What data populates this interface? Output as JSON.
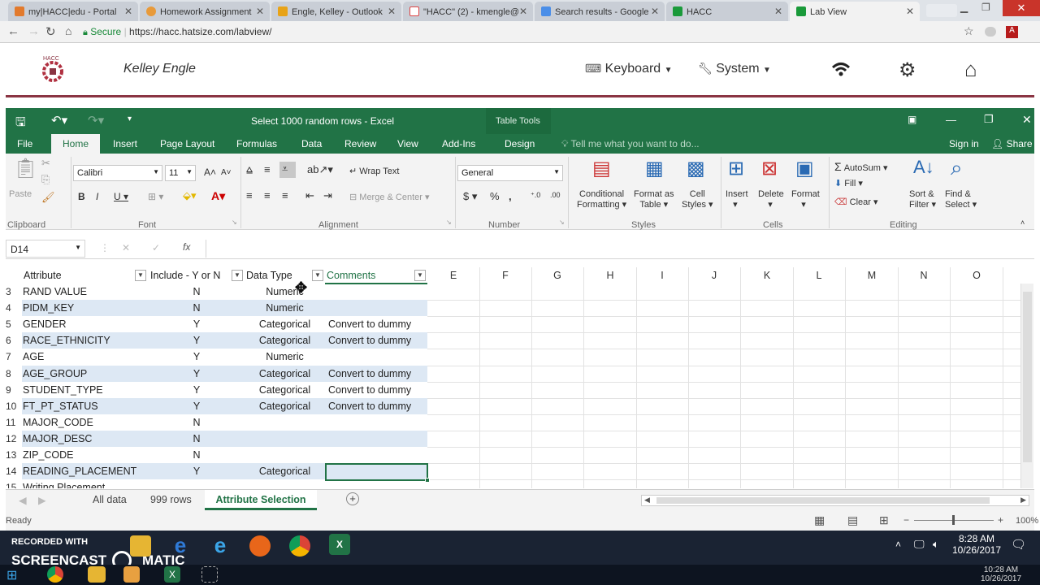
{
  "browser": {
    "tabs": [
      "my|HACC|edu - Portal",
      "Homework Assignment",
      "Engle, Kelley - Outlook",
      "\"HACC\" (2) - kmengle@",
      "Search results - Google",
      "HACC",
      "Lab View"
    ],
    "secure_label": "Secure",
    "url": "https://hacc.hatsize.com/labview/"
  },
  "lab": {
    "user": "Kelley Engle",
    "keyboard": "Keyboard",
    "system": "System"
  },
  "excel": {
    "title": "Select 1000 random rows  -  Excel",
    "table_tools": "Table Tools",
    "tabs": [
      "File",
      "Home",
      "Insert",
      "Page Layout",
      "Formulas",
      "Data",
      "Review",
      "View",
      "Add-Ins",
      "Design"
    ],
    "tell_me": "Tell me what you want to do...",
    "sign_in": "Sign in",
    "share": "Share",
    "ribbon": {
      "paste": "Paste",
      "clipboard": "Clipboard",
      "font_name": "Calibri",
      "font_size": "11",
      "font": "Font",
      "wrap_text": "Wrap Text",
      "merge_center": "Merge & Center",
      "alignment": "Alignment",
      "number_format": "General",
      "number": "Number",
      "conditional_formatting": [
        "Conditional",
        "Formatting"
      ],
      "format_as_table": [
        "Format as",
        "Table"
      ],
      "cell_styles": [
        "Cell",
        "Styles"
      ],
      "styles": "Styles",
      "insert": "Insert",
      "delete": "Delete",
      "format": "Format",
      "cells": "Cells",
      "autosum": "AutoSum",
      "fill": "Fill",
      "clear": "Clear",
      "sort_filter": [
        "Sort &",
        "Filter"
      ],
      "find_select": [
        "Find &",
        "Select"
      ],
      "editing": "Editing"
    },
    "name_box": "D14",
    "fx": "fx",
    "columns": [
      "E",
      "F",
      "G",
      "H",
      "I",
      "J",
      "K",
      "L",
      "M",
      "N",
      "O"
    ],
    "headers": [
      "Attribute",
      "Include - Y or N",
      "Data Type",
      "Comments"
    ],
    "rows": [
      {
        "n": "3",
        "attr": "RAND VALUE",
        "inc": "N",
        "type": "Numeric",
        "comment": ""
      },
      {
        "n": "4",
        "attr": "PIDM_KEY",
        "inc": "N",
        "type": "Numeric",
        "comment": ""
      },
      {
        "n": "5",
        "attr": "GENDER",
        "inc": "Y",
        "type": "Categorical",
        "comment": "Convert to dummy"
      },
      {
        "n": "6",
        "attr": "RACE_ETHNICITY",
        "inc": "Y",
        "type": "Categorical",
        "comment": "Convert to dummy"
      },
      {
        "n": "7",
        "attr": "AGE",
        "inc": "Y",
        "type": "Numeric",
        "comment": ""
      },
      {
        "n": "8",
        "attr": "AGE_GROUP",
        "inc": "Y",
        "type": "Categorical",
        "comment": "Convert to dummy"
      },
      {
        "n": "9",
        "attr": "STUDENT_TYPE",
        "inc": "Y",
        "type": "Categorical",
        "comment": "Convert to dummy"
      },
      {
        "n": "10",
        "attr": "FT_PT_STATUS",
        "inc": "Y",
        "type": "Categorical",
        "comment": "Convert to dummy"
      },
      {
        "n": "11",
        "attr": "MAJOR_CODE",
        "inc": "N",
        "type": "",
        "comment": ""
      },
      {
        "n": "12",
        "attr": "MAJOR_DESC",
        "inc": "N",
        "type": "",
        "comment": ""
      },
      {
        "n": "13",
        "attr": "ZIP_CODE",
        "inc": "N",
        "type": "",
        "comment": ""
      },
      {
        "n": "14",
        "attr": "READING_PLACEMENT",
        "inc": "Y",
        "type": "Categorical",
        "comment": ""
      },
      {
        "n": "15",
        "attr": "Writing Placement",
        "inc": "",
        "type": "",
        "comment": ""
      }
    ],
    "sheet_tabs": [
      "All data",
      "999 rows",
      "Attribute Selection"
    ],
    "status": "Ready",
    "zoom": "100%"
  },
  "taskbar": {
    "watermark_line1": "RECORDED WITH",
    "watermark_line2": "SCREENCAST",
    "watermark_line3": "MATIC",
    "time": "8:28 AM",
    "date": "10/26/2017",
    "time2": "10:28 AM",
    "date2": "10/26/2017"
  }
}
